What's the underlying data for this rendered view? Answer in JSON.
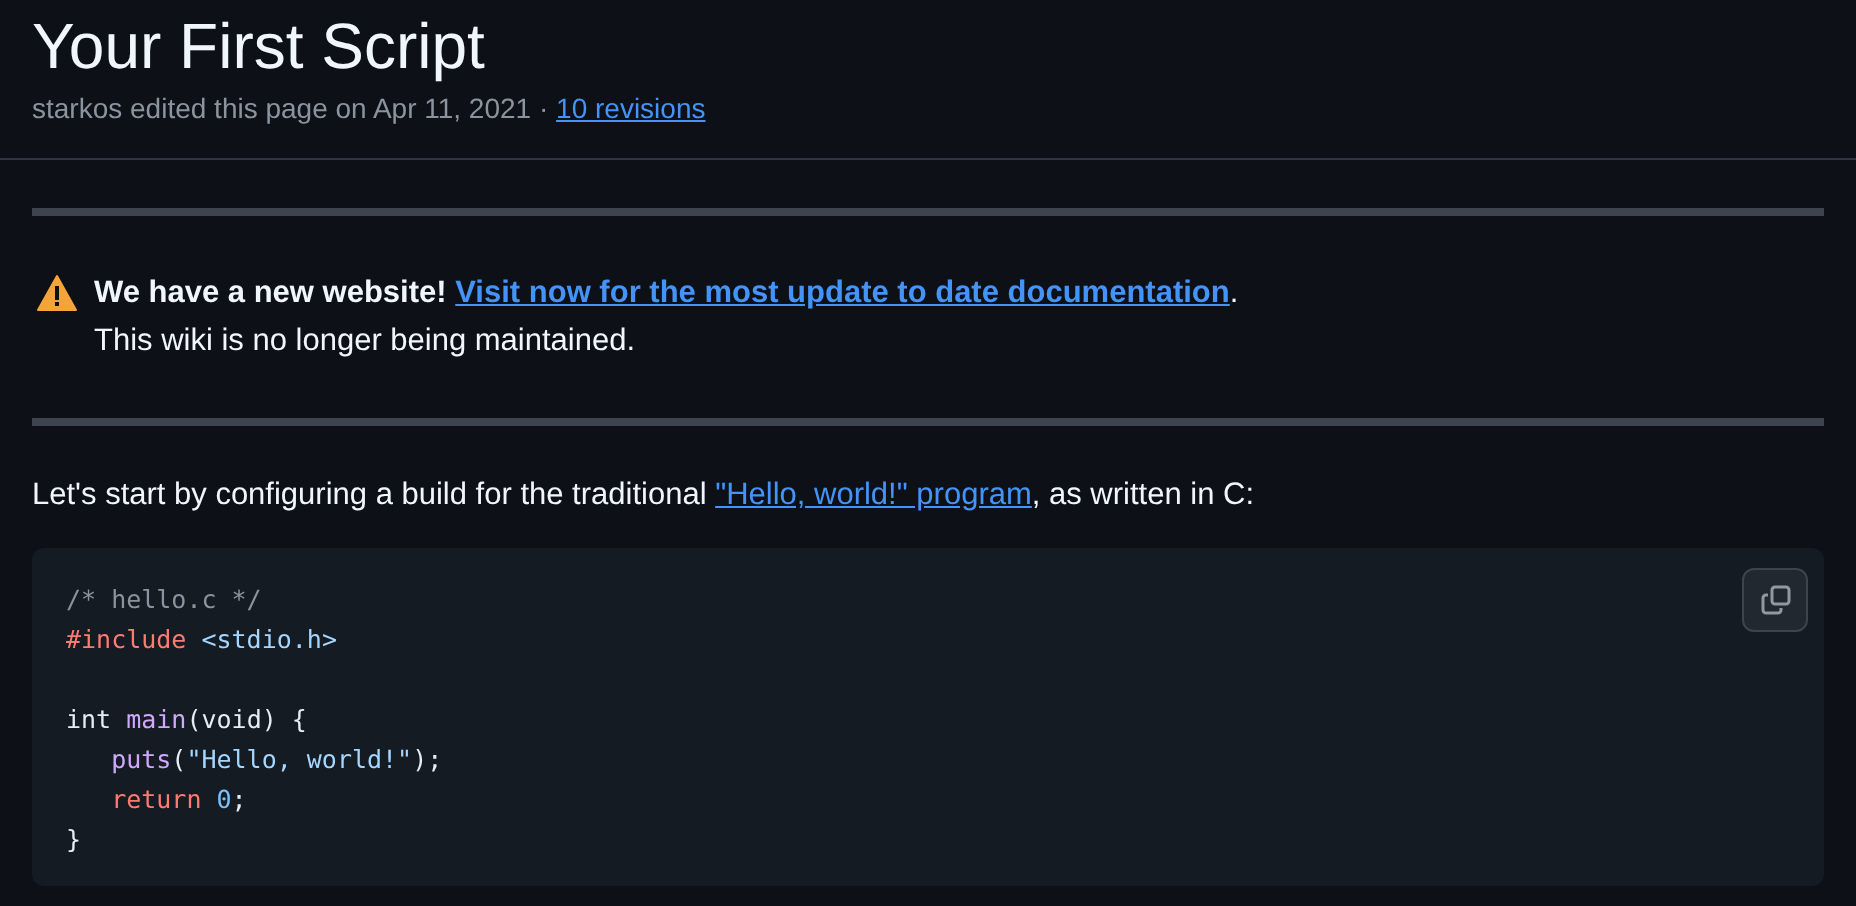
{
  "page": {
    "title": "Your First Script",
    "meta": "starkos edited this page on Apr 11, 2021 · ",
    "revisions_link": "10 revisions"
  },
  "notice": {
    "kind": "warning",
    "strong": "We have a new website!",
    "link": "Visit now for the most update to date documentation",
    "after": ".",
    "line2": "This wiki is no longer being maintained."
  },
  "intro": {
    "before": "Let's start by configuring a build for the traditional ",
    "link": "\"Hello, world!\" program",
    "after": ", as written in C:"
  },
  "code": {
    "lines": [
      {
        "kind": "code",
        "tokens": [
          {
            "kind": "comment",
            "text": "/* hello.c */"
          }
        ]
      },
      {
        "kind": "code",
        "tokens": [
          {
            "kind": "keyword",
            "text": "#include"
          },
          {
            "kind": "string",
            "text": "<stdio.h>",
            "space_before": true
          }
        ]
      },
      {
        "kind": "blank"
      },
      {
        "kind": "code",
        "tokens": [
          {
            "kind": "plain",
            "text": "int "
          },
          {
            "kind": "function",
            "text": "main"
          },
          {
            "kind": "plain",
            "text": "(void) {"
          }
        ]
      },
      {
        "kind": "code",
        "indented": true,
        "tokens": [
          {
            "kind": "function",
            "text": "puts"
          },
          {
            "kind": "plain",
            "text": "("
          },
          {
            "kind": "string",
            "text": "\"Hello, world!\""
          },
          {
            "kind": "plain",
            "text": ");"
          }
        ]
      },
      {
        "kind": "code",
        "indented": true,
        "tokens": [
          {
            "kind": "keyword",
            "text": "return"
          },
          {
            "kind": "number",
            "text": "0",
            "space_before": true
          },
          {
            "kind": "plain",
            "text": ";"
          }
        ]
      },
      {
        "kind": "code",
        "tokens": [
          {
            "kind": "plain",
            "text": "}"
          }
        ]
      }
    ]
  }
}
